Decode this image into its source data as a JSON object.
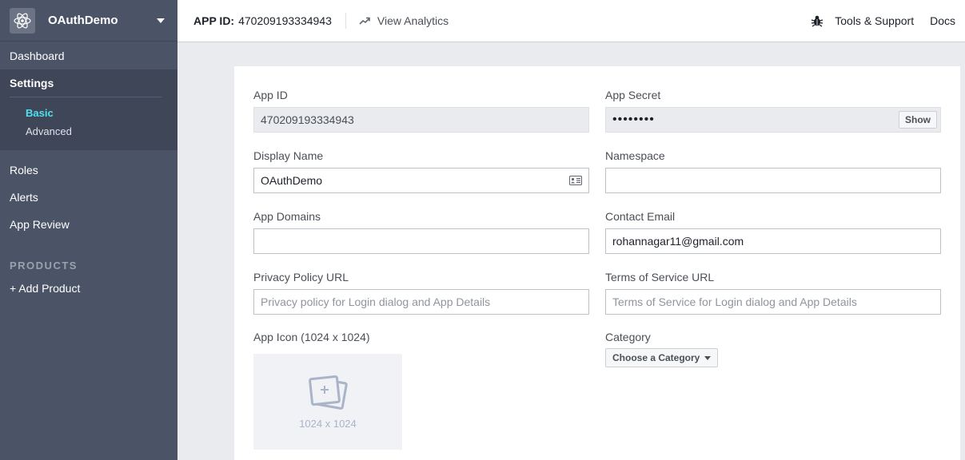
{
  "sidebar": {
    "app_name": "OAuthDemo",
    "items": [
      {
        "label": "Dashboard"
      },
      {
        "label": "Settings"
      },
      {
        "label": "Roles"
      },
      {
        "label": "Alerts"
      },
      {
        "label": "App Review"
      }
    ],
    "settings_subitems": [
      {
        "label": "Basic",
        "active": true
      },
      {
        "label": "Advanced",
        "active": false
      }
    ],
    "products_title": "PRODUCTS",
    "add_product": "+ Add Product"
  },
  "topbar": {
    "app_id_label": "APP ID:",
    "app_id_value": "470209193334943",
    "analytics_label": "View Analytics",
    "tools_label": "Tools & Support",
    "docs_label": "Docs"
  },
  "form": {
    "app_id": {
      "label": "App ID",
      "value": "470209193334943"
    },
    "app_secret": {
      "label": "App Secret",
      "value": "••••••••",
      "show_label": "Show"
    },
    "display_name": {
      "label": "Display Name",
      "value": "OAuthDemo"
    },
    "namespace": {
      "label": "Namespace",
      "value": ""
    },
    "app_domains": {
      "label": "App Domains",
      "value": ""
    },
    "contact_email": {
      "label": "Contact Email",
      "value": "rohannagar11@gmail.com"
    },
    "privacy_url": {
      "label": "Privacy Policy URL",
      "placeholder": "Privacy policy for Login dialog and App Details"
    },
    "tos_url": {
      "label": "Terms of Service URL",
      "placeholder": "Terms of Service for Login dialog and App Details"
    },
    "app_icon": {
      "label": "App Icon (1024 x 1024)",
      "dimensions": "1024 x 1024"
    },
    "category": {
      "label": "Category",
      "selected": "Choose a Category"
    }
  },
  "colors": {
    "sidebar_bg": "#4b5467",
    "sidebar_active_bg": "#3e4657",
    "active_subitem": "#4fe0f0"
  },
  "icons": {
    "app_logo": "react-atom-icon",
    "analytics": "trend-arrow-icon",
    "tools": "bug-icon",
    "contact_card": "contact-card-icon",
    "app_icon_placeholder": "photo-add-icon"
  }
}
